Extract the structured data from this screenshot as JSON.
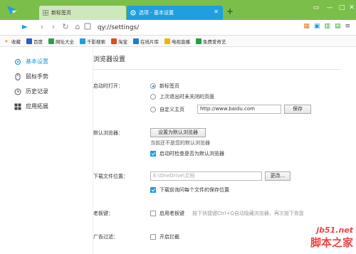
{
  "tabs": [
    {
      "label": "新标签页",
      "active": false
    },
    {
      "label": "选项 - 基本设置",
      "active": true
    }
  ],
  "address": "qy://settings/",
  "bookmarks": [
    "收藏",
    "百度",
    "网址大全",
    "千影搜索",
    "淘宝",
    "在线片库",
    "电视直播",
    "免费爱奇艺"
  ],
  "sidebar": {
    "items": [
      {
        "label": "基本设置",
        "icon": "gear-icon"
      },
      {
        "label": "鼠标手势",
        "icon": "mouse-icon"
      },
      {
        "label": "历史记录",
        "icon": "clock-icon"
      },
      {
        "label": "应用拓展",
        "icon": "grid-icon"
      }
    ]
  },
  "page_title": "浏览器设置",
  "startup": {
    "label": "启动时打开：",
    "options": [
      "新标签页",
      "上次退出时未关闭的页面",
      "自定义主页"
    ],
    "selected": 0,
    "homepage_value": "http://www.baidu.com",
    "save_label": "保存"
  },
  "default_browser": {
    "label": "默认浏览器：",
    "button_label": "设置为默认浏览器",
    "status": "当前还不是您的默认浏览器",
    "check_label": "启动时检查是否为默认浏览器"
  },
  "download": {
    "label": "下载文件位置：",
    "path_value": "E:\\OneDrive\\文档",
    "change_label": "更改...",
    "ask_label": "下载前询问每个文件的保存位置"
  },
  "boss_key": {
    "label": "老板键：",
    "check_label": "启用老板键",
    "note": "按下快捷键Ctrl+Q自动隐藏浏览器，再次按下恢复"
  },
  "adblock": {
    "label": "广告过滤：",
    "check_label": "开启拦截"
  },
  "watermark": {
    "top": "jb51.net",
    "bottom": "脚本之家"
  },
  "colors": {
    "accent": "#1f9ee0",
    "chrome_green": "#7bbf4a"
  }
}
